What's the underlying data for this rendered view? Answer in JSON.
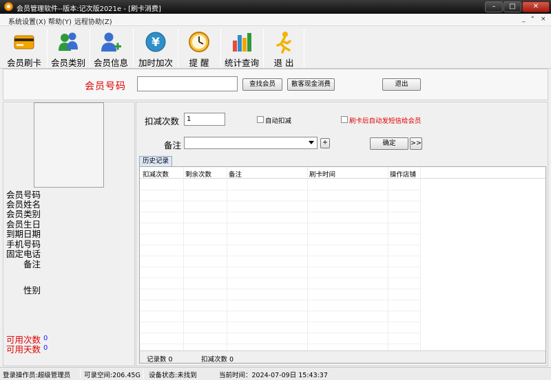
{
  "window": {
    "title": "会员管理软件--版本:记次版2021e - [刷卡消费]",
    "minimize_glyph": "–",
    "maximize_glyph": "□",
    "close_glyph": "✕"
  },
  "menu": {
    "items": [
      {
        "label": "系统设置(X)"
      },
      {
        "label": "帮助(Y)"
      },
      {
        "label": "远程协助(Z)"
      }
    ],
    "mdi_controls": [
      "_",
      "°",
      "×"
    ]
  },
  "toolbar": {
    "buttons": [
      {
        "label": "会员刷卡",
        "icon": "card-icon"
      },
      {
        "label": "会员类别",
        "icon": "users-icon"
      },
      {
        "label": "会员信息",
        "icon": "add-user-icon"
      },
      {
        "label": "加时加次",
        "icon": "yen-icon"
      },
      {
        "label": "提 醒",
        "icon": "clock-icon"
      },
      {
        "label": "统计查询",
        "icon": "bar-chart-icon"
      },
      {
        "label": "退 出",
        "icon": "exit-runner-icon"
      }
    ]
  },
  "search": {
    "label": "会员号码",
    "value": "",
    "find_button": "查找会员",
    "guest_cash_button": "散客现金消费",
    "exit_button": "退出"
  },
  "member": {
    "fields": [
      "会员号码",
      "会员姓名",
      "会员类别",
      "会员生日",
      "到期日期",
      "手机号码",
      "固定电话",
      "备注",
      "性别"
    ],
    "available_count_label": "可用次数",
    "available_count_value": "0",
    "available_days_label": "可用天数",
    "available_days_value": "0"
  },
  "consume": {
    "deduct_count_label": "扣减次数",
    "deduct_count_value": "1",
    "auto_deduct_label": "自动扣减",
    "auto_sms_label": "刷卡后自动发短信给会员",
    "remark_label": "备注",
    "remark_value": "",
    "add_button": "+",
    "confirm_button": "确定",
    "more_button": ">>"
  },
  "history": {
    "tab": "历史记录",
    "columns": [
      "扣减次数",
      "剩余次数",
      "备注",
      "刷卡时间",
      "操作店铺"
    ],
    "footer_records": "记录数 0",
    "footer_deduct": "扣减次数 0"
  },
  "status": {
    "operator": "登录操作员:超级管理员",
    "space": "可录空间:206.45G",
    "device": "设备状态:未找到",
    "time": "当前时间：2024-07-09日 15:43:37"
  },
  "colors": {
    "accent_red": "#e00000",
    "value_blue": "#1a1aff",
    "titlebar": "#1a1a1a"
  }
}
